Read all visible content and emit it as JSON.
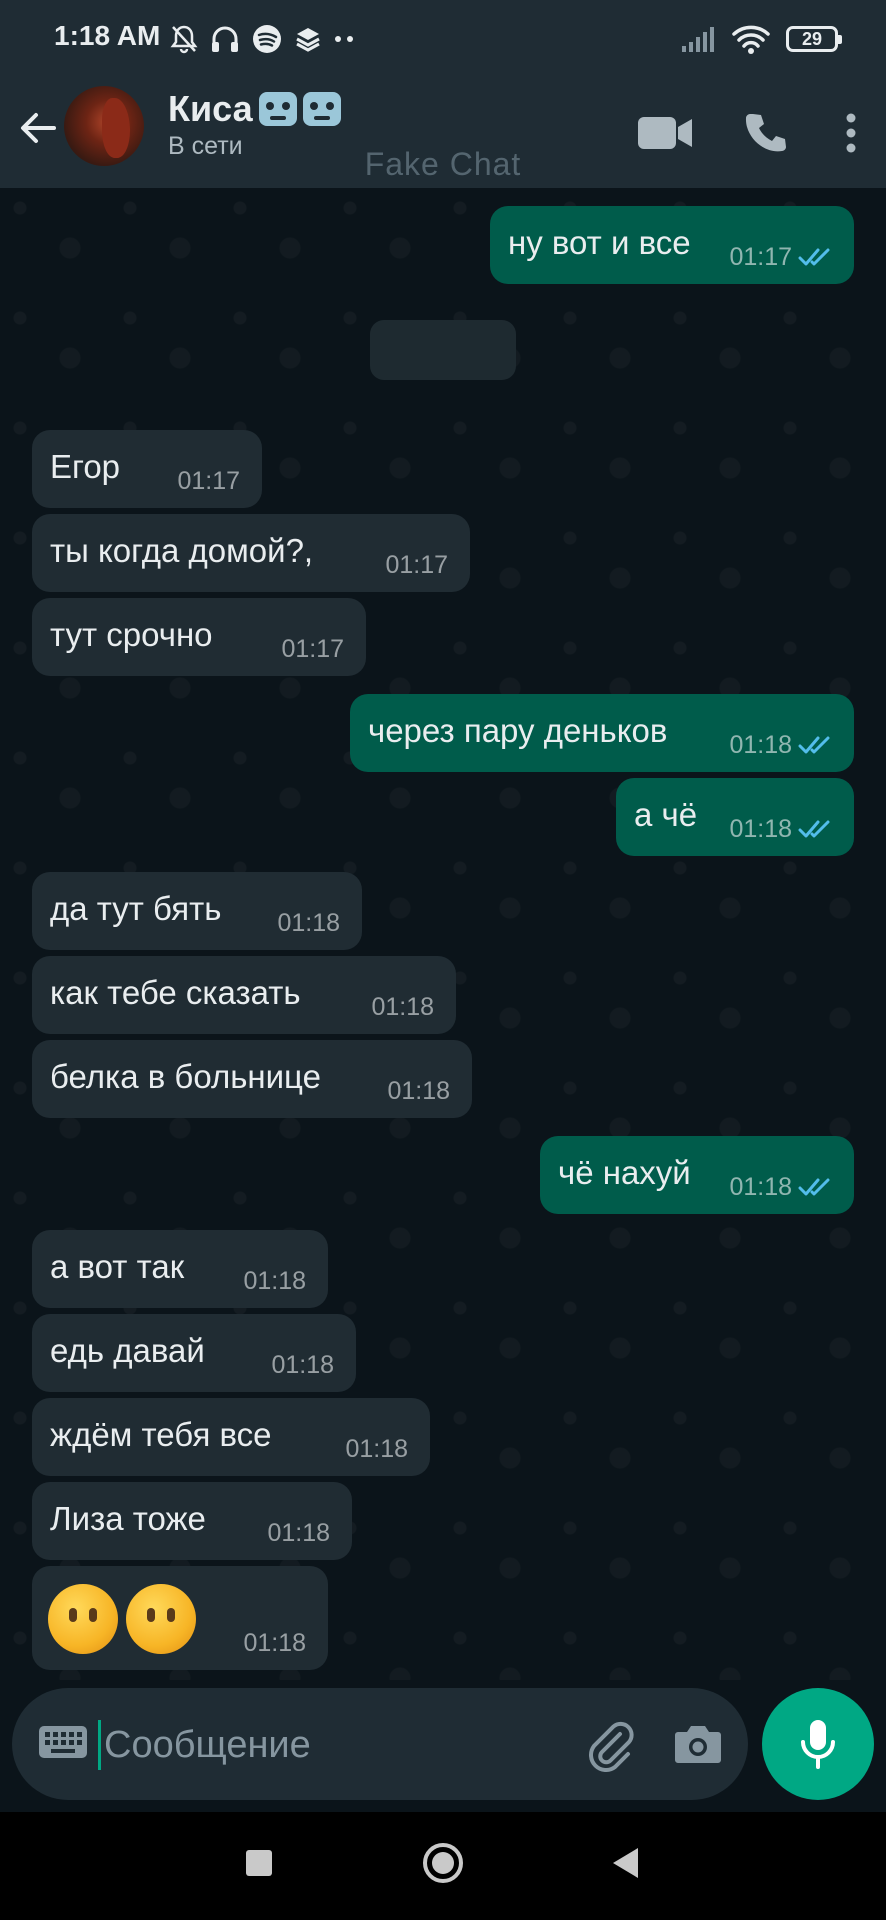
{
  "status_bar": {
    "time": "1:18 AM",
    "battery": "29",
    "icons_left": [
      "mute-bell-icon",
      "headphones-icon",
      "spotify-icon",
      "layers-icon",
      "more-dots-icon"
    ],
    "icons_right": [
      "signal-icon",
      "wifi-icon",
      "battery-icon"
    ]
  },
  "header": {
    "contact_name": "Киса",
    "name_emojis": [
      "robot-emoji",
      "robot-emoji"
    ],
    "contact_status": "В сети",
    "watermark": "Fake Chat",
    "actions": [
      "video-call-icon",
      "phone-call-icon",
      "more-vert-icon"
    ]
  },
  "messages": [
    {
      "dir": "out",
      "text": "ну вот и все",
      "time": "01:17",
      "read": true
    },
    {
      "dir": "in",
      "text": "Егор",
      "time": "01:17"
    },
    {
      "dir": "in",
      "text": "ты когда домой?,",
      "time": "01:17"
    },
    {
      "dir": "in",
      "text": "тут срочно",
      "time": "01:17"
    },
    {
      "dir": "out",
      "text": "через пару деньков",
      "time": "01:18",
      "read": true
    },
    {
      "dir": "out",
      "text": "а чё",
      "time": "01:18",
      "read": true
    },
    {
      "dir": "in",
      "text": "да тут бять",
      "time": "01:18"
    },
    {
      "dir": "in",
      "text": "как тебе сказать",
      "time": "01:18"
    },
    {
      "dir": "in",
      "text": "белка в больнице",
      "time": "01:18"
    },
    {
      "dir": "out",
      "text": "чё нахуй",
      "time": "01:18",
      "read": true
    },
    {
      "dir": "in",
      "text": "а вот так",
      "time": "01:18"
    },
    {
      "dir": "in",
      "text": "едь давай",
      "time": "01:18"
    },
    {
      "dir": "in",
      "text": "ждём тебя все",
      "time": "01:18"
    },
    {
      "dir": "in",
      "text": "Лиза тоже",
      "time": "01:18"
    },
    {
      "dir": "in",
      "emojis": [
        "no-mouth-face-emoji",
        "no-mouth-face-emoji"
      ],
      "time": "01:18"
    }
  ],
  "input": {
    "placeholder": "Сообщение",
    "value": ""
  },
  "colors": {
    "background": "#0b141a",
    "bar": "#1f2c34",
    "incoming_bubble": "#202c33",
    "outgoing_bubble": "#005c4b",
    "accent": "#00a884",
    "read_ticks": "#53bdeb"
  }
}
